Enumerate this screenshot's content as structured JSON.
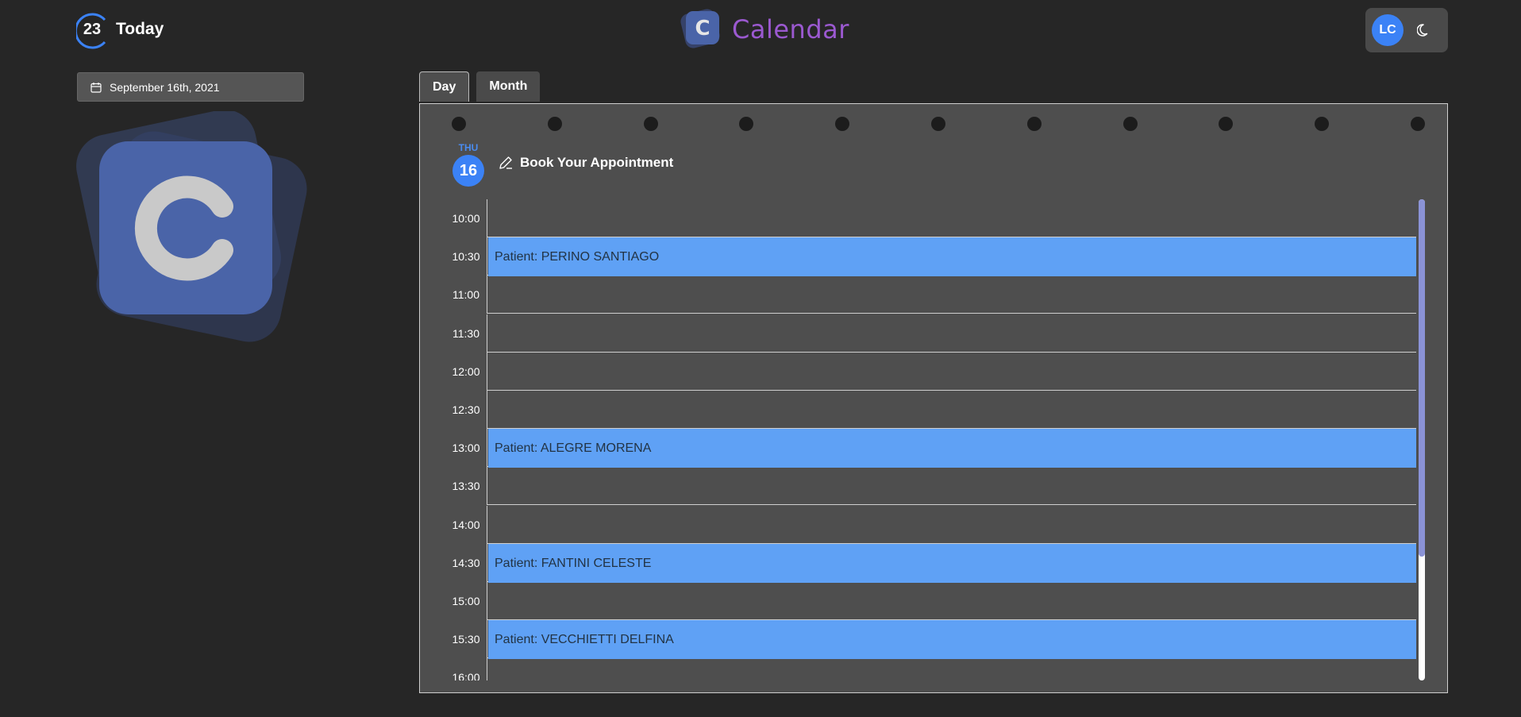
{
  "header": {
    "today_number": "23",
    "today_label": "Today",
    "brand_name": "Calendar",
    "brand_letter": "C",
    "user_initials": "LC",
    "theme_icon": "moon-icon"
  },
  "sidebar": {
    "date_value": "September 16th, 2021",
    "logo_letter": "C"
  },
  "tabs": [
    {
      "label": "Day",
      "active": true
    },
    {
      "label": "Month",
      "active": false
    }
  ],
  "day": {
    "weekday": "THU",
    "date": "16",
    "book_label": "Book Your Appointment"
  },
  "schedule": [
    {
      "time": "10:00",
      "appointment": ""
    },
    {
      "time": "10:30",
      "appointment": "Patient: PERINO SANTIAGO"
    },
    {
      "time": "11:00",
      "appointment": ""
    },
    {
      "time": "11:30",
      "appointment": ""
    },
    {
      "time": "12:00",
      "appointment": ""
    },
    {
      "time": "12:30",
      "appointment": ""
    },
    {
      "time": "13:00",
      "appointment": "Patient: ALEGRE MORENA"
    },
    {
      "time": "13:30",
      "appointment": ""
    },
    {
      "time": "14:00",
      "appointment": ""
    },
    {
      "time": "14:30",
      "appointment": "Patient: FANTINI CELESTE"
    },
    {
      "time": "15:00",
      "appointment": ""
    },
    {
      "time": "15:30",
      "appointment": "Patient: VECCHIETTI DELFINA"
    },
    {
      "time": "16:00",
      "appointment": ""
    }
  ],
  "colors": {
    "background": "#262626",
    "panel": "#4e4e4e",
    "accent_blue": "#3b82f6",
    "appointment": "#5fa1f5",
    "brand_purple": "#9b59d0",
    "logo_blue": "#4a64a8"
  }
}
